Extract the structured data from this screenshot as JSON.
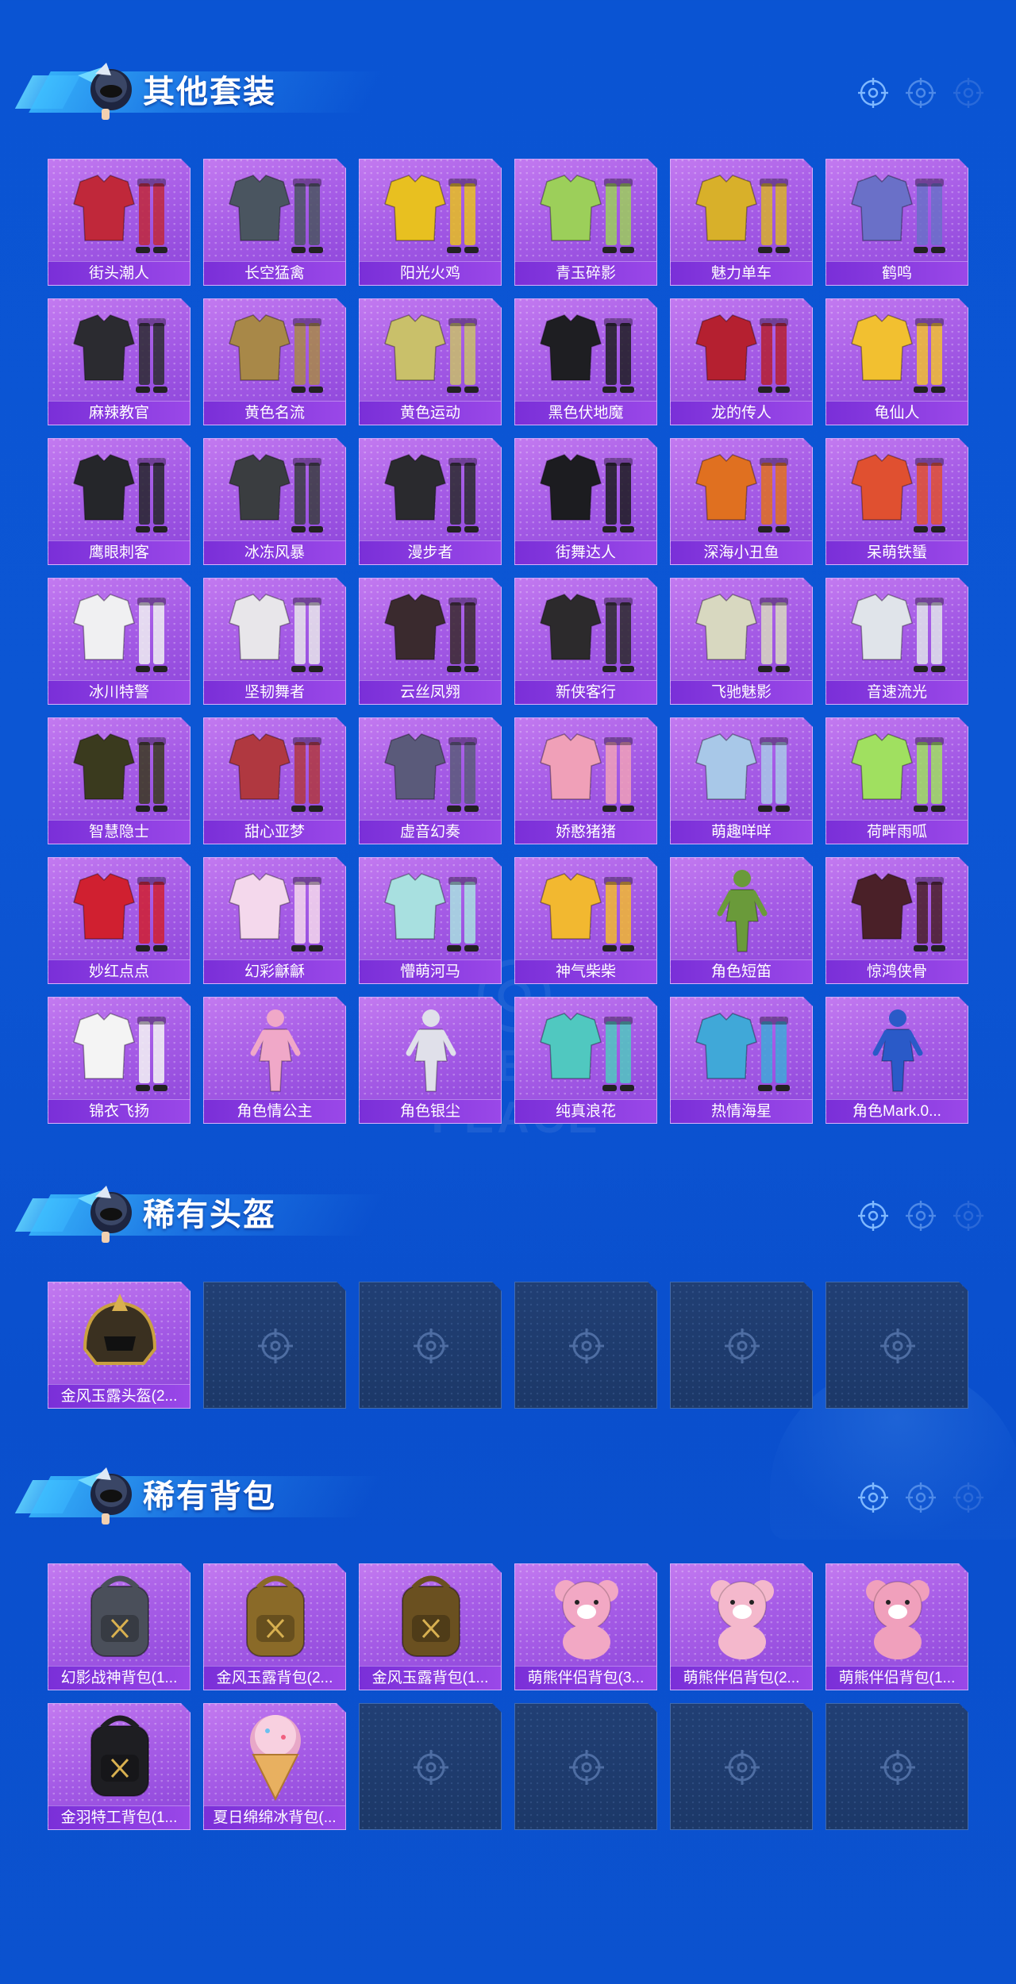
{
  "sections": [
    {
      "title": "其他套装",
      "items": [
        {
          "label": "街头潮人",
          "kind": "outfit",
          "color": "#c0283a"
        },
        {
          "label": "长空猛禽",
          "kind": "outfit",
          "color": "#4a5560"
        },
        {
          "label": "阳光火鸡",
          "kind": "outfit",
          "color": "#e8c020"
        },
        {
          "label": "青玉碎影",
          "kind": "outfit",
          "color": "#9ccf5a"
        },
        {
          "label": "魅力单车",
          "kind": "outfit",
          "color": "#d8b02a"
        },
        {
          "label": "鹤鸣",
          "kind": "outfit",
          "color": "#6a70c8"
        },
        {
          "label": "麻辣教官",
          "kind": "outfit",
          "color": "#2b2b30"
        },
        {
          "label": "黄色名流",
          "kind": "outfit",
          "color": "#a88848"
        },
        {
          "label": "黄色运动",
          "kind": "outfit",
          "color": "#c9c06a"
        },
        {
          "label": "黑色伏地魔",
          "kind": "outfit",
          "color": "#1e1e22"
        },
        {
          "label": "龙的传人",
          "kind": "outfit",
          "color": "#b52030"
        },
        {
          "label": "龟仙人",
          "kind": "outfit",
          "color": "#f2c030"
        },
        {
          "label": "鹰眼刺客",
          "kind": "outfit",
          "color": "#25262a"
        },
        {
          "label": "冰冻风暴",
          "kind": "outfit",
          "color": "#3a3d40"
        },
        {
          "label": "漫步者",
          "kind": "outfit",
          "color": "#2a2a2e"
        },
        {
          "label": "街舞达人",
          "kind": "outfit",
          "color": "#1c1c20"
        },
        {
          "label": "深海小丑鱼",
          "kind": "outfit",
          "color": "#e07020"
        },
        {
          "label": "呆萌铁蜑",
          "kind": "outfit",
          "color": "#e05030"
        },
        {
          "label": "冰川特警",
          "kind": "outfit",
          "color": "#f0f0f2"
        },
        {
          "label": "坚韧舞者",
          "kind": "outfit",
          "color": "#e8e6ea"
        },
        {
          "label": "云丝凤翙",
          "kind": "outfit",
          "color": "#3a2a2e"
        },
        {
          "label": "新侠客行",
          "kind": "outfit",
          "color": "#2c2a2c"
        },
        {
          "label": "飞驰魅影",
          "kind": "outfit",
          "color": "#d8d8c0"
        },
        {
          "label": "音速流光",
          "kind": "outfit",
          "color": "#e0e4ea"
        },
        {
          "label": "智慧隐士",
          "kind": "outfit",
          "color": "#3a3a1e"
        },
        {
          "label": "甜心亚梦",
          "kind": "outfit",
          "color": "#b03840"
        },
        {
          "label": "虚音幻奏",
          "kind": "outfit",
          "color": "#5a5a7a"
        },
        {
          "label": "娇憨猪猪",
          "kind": "outfit",
          "color": "#f0a0b8"
        },
        {
          "label": "萌趣咩咩",
          "kind": "outfit",
          "color": "#a8c8e8"
        },
        {
          "label": "荷畔雨呱",
          "kind": "outfit",
          "color": "#a0e060"
        },
        {
          "label": "妙红点点",
          "kind": "outfit",
          "color": "#d02030"
        },
        {
          "label": "幻彩龢龢",
          "kind": "outfit",
          "color": "#f4d8ec"
        },
        {
          "label": "懵萌河马",
          "kind": "outfit",
          "color": "#a8e0e0"
        },
        {
          "label": "神气柴柴",
          "kind": "outfit",
          "color": "#f2b830"
        },
        {
          "label": "角色短笛",
          "kind": "figure",
          "color": "#6a9a3a"
        },
        {
          "label": "惊鸿侠骨",
          "kind": "outfit",
          "color": "#4a2028"
        },
        {
          "label": "锦衣飞扬",
          "kind": "outfit",
          "color": "#f4f4f4"
        },
        {
          "label": "角色情公主",
          "kind": "figure",
          "color": "#f0a8c8"
        },
        {
          "label": "角色银尘",
          "kind": "figure",
          "color": "#e0e0ea"
        },
        {
          "label": "纯真浪花",
          "kind": "outfit",
          "color": "#50c8c0"
        },
        {
          "label": "热情海星",
          "kind": "outfit",
          "color": "#40a8d8"
        },
        {
          "label": "角色Mark.0...",
          "kind": "figure",
          "color": "#2a5ac8"
        }
      ]
    },
    {
      "title": "稀有头盔",
      "items": [
        {
          "label": "金风玉露头盔(2...",
          "kind": "helmet",
          "color": "#3a3020"
        },
        {
          "label": "",
          "kind": "empty"
        },
        {
          "label": "",
          "kind": "empty"
        },
        {
          "label": "",
          "kind": "empty"
        },
        {
          "label": "",
          "kind": "empty"
        },
        {
          "label": "",
          "kind": "empty"
        }
      ]
    },
    {
      "title": "稀有背包",
      "items": [
        {
          "label": "幻影战神背包(1...",
          "kind": "backpack",
          "color": "#4a4f5a"
        },
        {
          "label": "金风玉露背包(2...",
          "kind": "backpack",
          "color": "#8a6a28"
        },
        {
          "label": "金风玉露背包(1...",
          "kind": "backpack",
          "color": "#6a5020"
        },
        {
          "label": "萌熊伴侣背包(3...",
          "kind": "bear",
          "color": "#f2a8c4"
        },
        {
          "label": "萌熊伴侣背包(2...",
          "kind": "bear",
          "color": "#f4b8cc"
        },
        {
          "label": "萌熊伴侣背包(1...",
          "kind": "bear",
          "color": "#f0a0bc"
        },
        {
          "label": "金羽特工背包(1...",
          "kind": "backpack",
          "color": "#1e1e22"
        },
        {
          "label": "夏日绵绵冰背包(...",
          "kind": "icecream",
          "color": "#e8a8c8"
        },
        {
          "label": "",
          "kind": "empty"
        },
        {
          "label": "",
          "kind": "empty"
        },
        {
          "label": "",
          "kind": "empty"
        },
        {
          "label": "",
          "kind": "empty"
        }
      ]
    }
  ],
  "watermark": "GAME FOR PEACE"
}
